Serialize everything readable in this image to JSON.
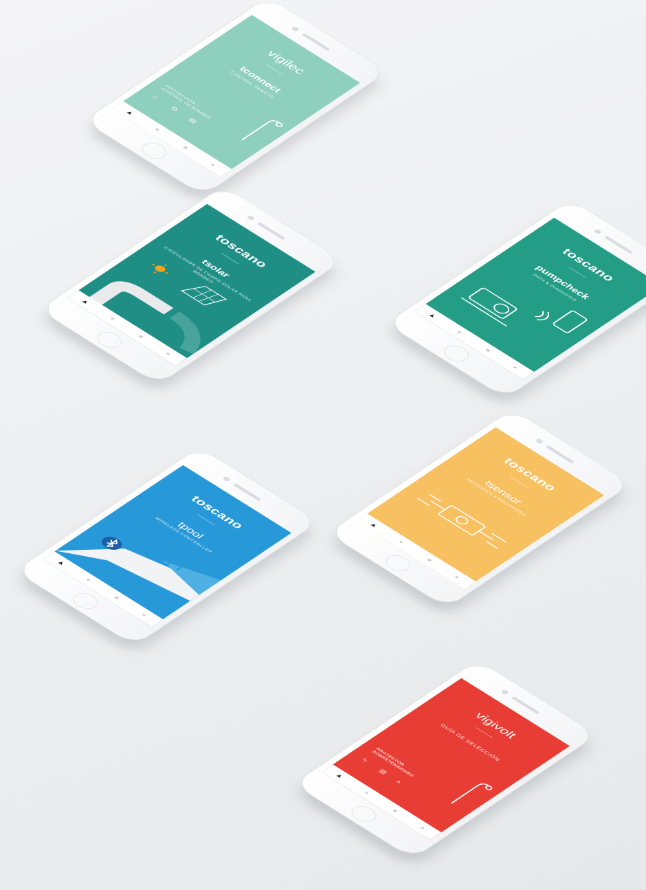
{
  "phones": {
    "vigilec": {
      "brand": "vigilec",
      "app": "tconnect",
      "subtitle": "CONTROL REMOTO",
      "section_label": "PROTECCIÓN + CONTROL DE BOMBEO",
      "screen_color": "#8fcfbd",
      "icons": [
        "pump-station-icon",
        "pump-icon",
        "meter-icon",
        "lamppost-icon"
      ]
    },
    "tsolar": {
      "brand": "toscano",
      "app": "tsolar",
      "subtitle": "CALCULADOR DE CAMPO SOLAR PARA BOMBEO",
      "screen_color": "#1f8f86",
      "icons": [
        "sun-icon",
        "solar-panel-icon",
        "pipe-icon"
      ]
    },
    "pumpcheck": {
      "brand": "toscano",
      "app": "pumpcheck",
      "subtitle": "DATA & DIAGNOSIS",
      "screen_color": "#249d86",
      "icons": [
        "pump-motor-icon",
        "wireless-signal-icon",
        "smartphone-icon"
      ]
    },
    "tpool": {
      "brand": "toscano",
      "app": "tpool",
      "subtitle": "WIRELESS CONTROLLER",
      "screen_color": "#2798d8",
      "icons": [
        "bluetooth-icon",
        "pool-ladder-icon"
      ]
    },
    "tsensor": {
      "brand": "toscano",
      "app": "tsensor",
      "subtitle": "SENSORES Y MEDIDORES",
      "screen_color": "#f7c061",
      "icons": [
        "flow-sensor-icon"
      ]
    },
    "vigivolt": {
      "brand": "vigivolt",
      "app": "GUÍA DE SELECCIÓN",
      "section_label": "PROTECTOR SOBRETENSIONES",
      "screen_color": "#e83d35",
      "icons": [
        "lightning-icon",
        "transformer-icon",
        "tower-icon",
        "lamppost-icon"
      ]
    }
  },
  "tabbar": [
    "home-icon",
    "heart-icon",
    "cart-icon",
    "user-icon"
  ]
}
